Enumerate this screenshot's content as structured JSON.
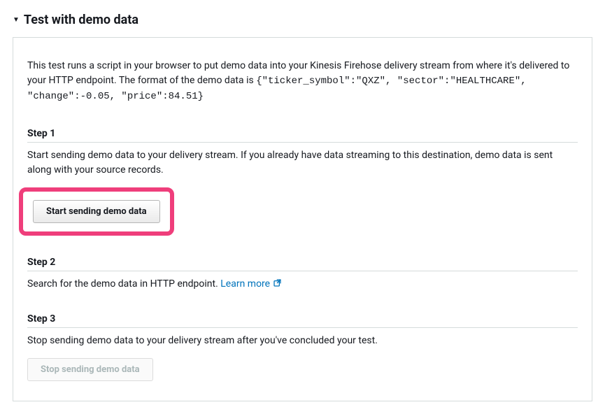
{
  "section": {
    "title": "Test with demo data"
  },
  "intro": {
    "text_before_code": "This test runs a script in your browser to put demo data into your Kinesis Firehose delivery stream from where it's delivered to your HTTP endpoint. The format of the demo data is ",
    "code": "{\"ticker_symbol\":\"QXZ\", \"sector\":\"HEALTHCARE\", \"change\":-0.05, \"price\":84.51}"
  },
  "steps": {
    "step1": {
      "title": "Step 1",
      "desc": "Start sending demo data to your delivery stream. If you already have data streaming to this destination, demo data is sent along with your source records.",
      "button_label": "Start sending demo data"
    },
    "step2": {
      "title": "Step 2",
      "desc_prefix": "Search for the demo data in HTTP endpoint. ",
      "link_text": "Learn more"
    },
    "step3": {
      "title": "Step 3",
      "desc": "Stop sending demo data to your delivery stream after you've concluded your test.",
      "button_label": "Stop sending demo data"
    }
  }
}
